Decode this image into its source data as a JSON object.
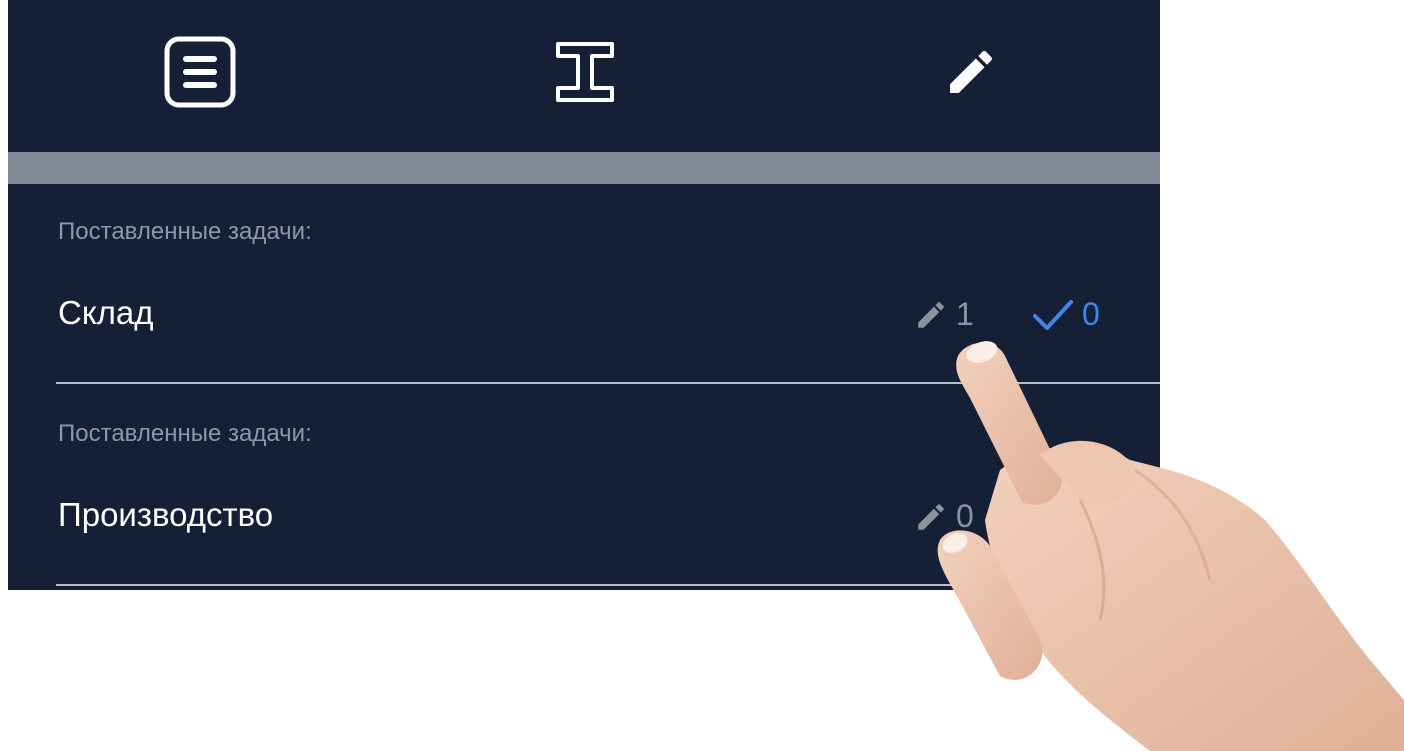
{
  "toolbar": {
    "buttons": [
      {
        "icon": "list-icon"
      },
      {
        "icon": "text-cursor-icon"
      },
      {
        "icon": "pencil-icon"
      }
    ]
  },
  "tasks": [
    {
      "caption": "Поставленные задачи:",
      "name": "Склад",
      "edit_count": "1",
      "done_count": "0"
    },
    {
      "caption": "Поставленные задачи:",
      "name": "Производство",
      "edit_count": "0"
    }
  ],
  "colors": {
    "background": "#152037",
    "divider": "#858c97",
    "caption": "#8e97a6",
    "done_accent": "#3f87e8",
    "edit_gray": "#8b939f"
  }
}
